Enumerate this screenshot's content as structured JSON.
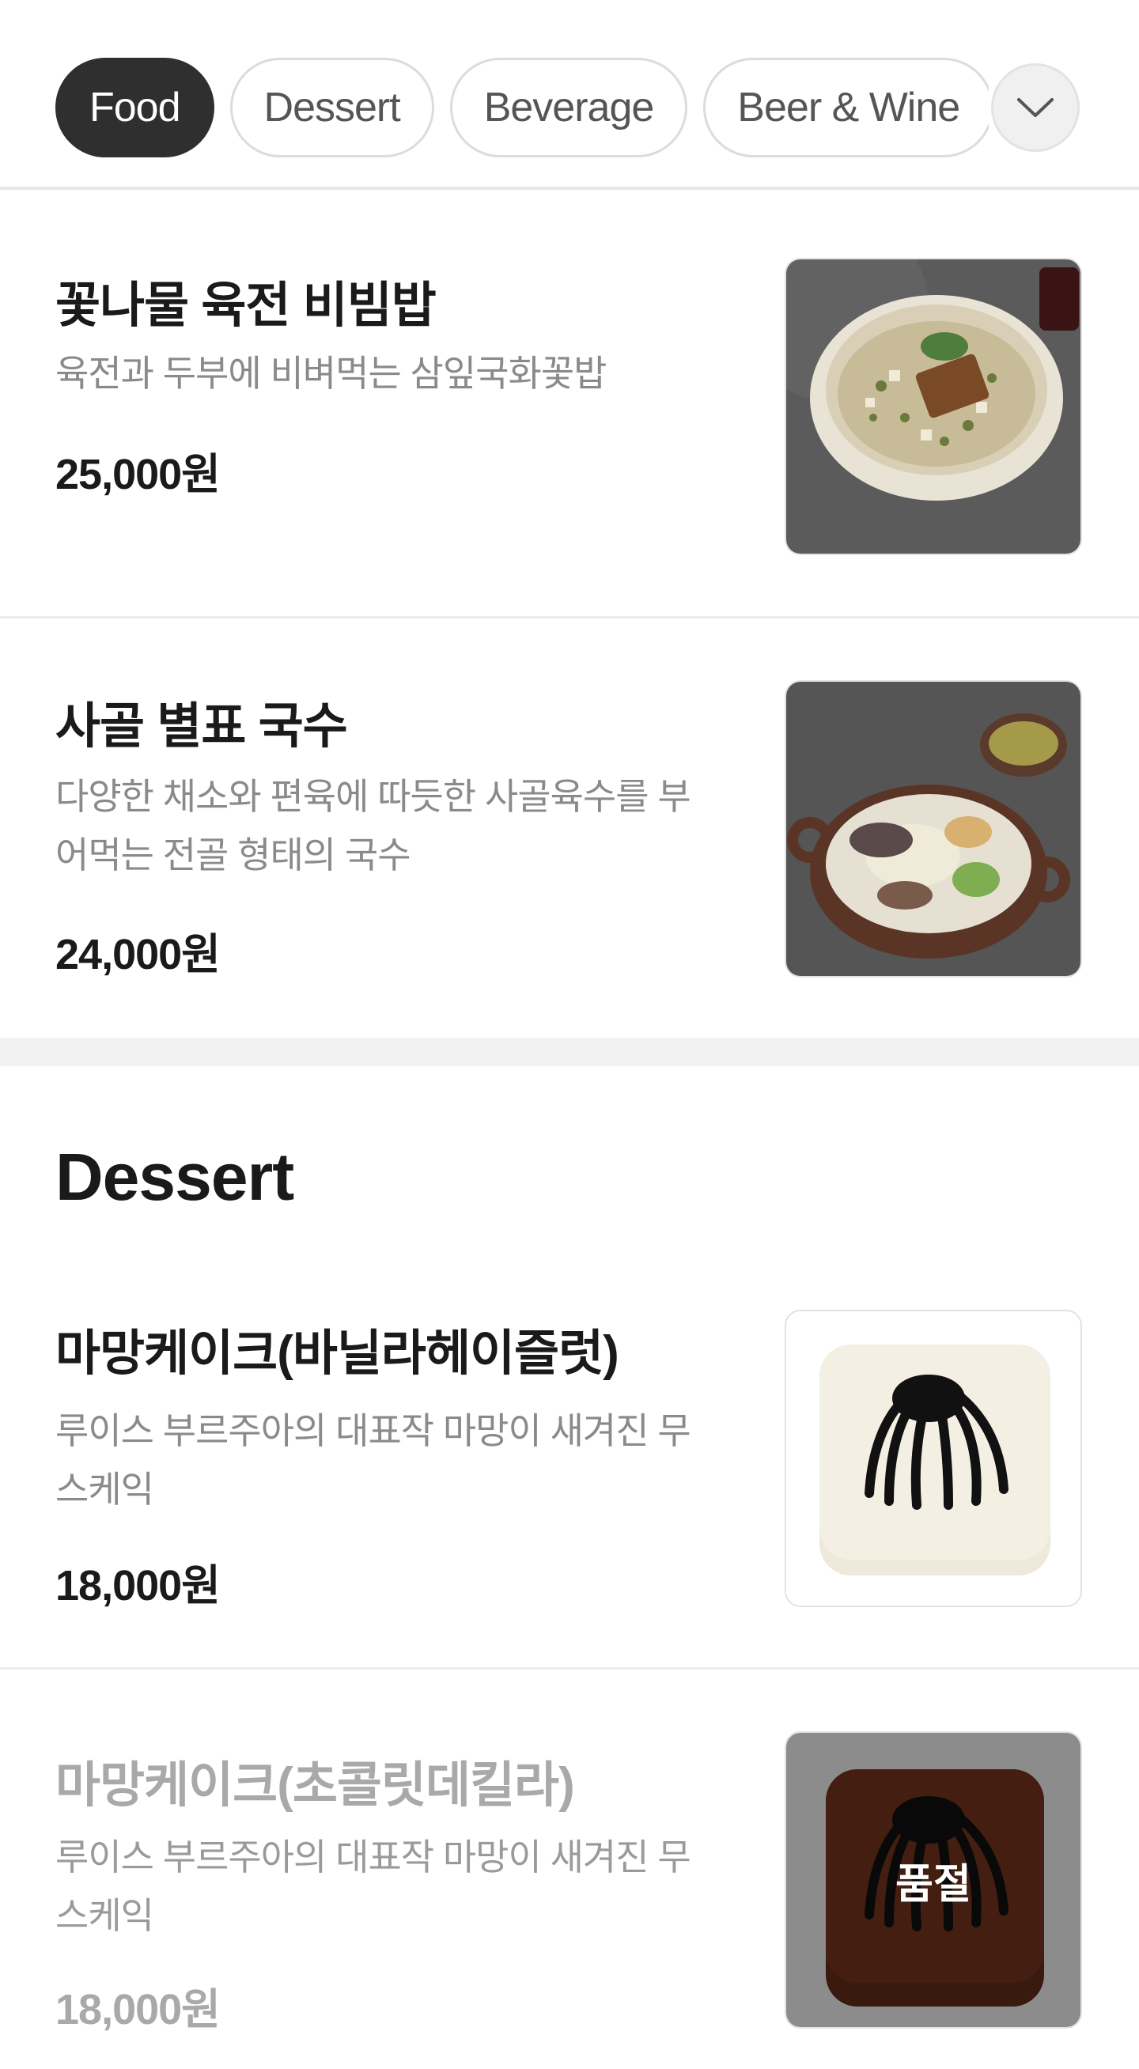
{
  "tabs": [
    {
      "label": "Food",
      "active": true
    },
    {
      "label": "Dessert",
      "active": false
    },
    {
      "label": "Beverage",
      "active": false
    },
    {
      "label": "Beer & Wine",
      "active": false
    }
  ],
  "more_icon": "chevron-down-icon",
  "items": [
    {
      "name": "꽃나물 육전 비빔밥",
      "desc": "육전과 두부에 비벼먹는 삼잎국화꽃밥",
      "price": "25,000원",
      "image": "bibimbap bowl"
    },
    {
      "name": "사골 별표 국수",
      "desc": "다양한 채소와 편육에 따듯한 사골육수를 부어먹는 전골 형태의 국수",
      "price": "24,000원",
      "image": "beef bone noodle pot"
    }
  ],
  "section": {
    "title": "Dessert"
  },
  "desserts": [
    {
      "name": "마망케이크(바닐라헤이즐럿)",
      "desc": "루이스 부르주아의 대표작 마망이 새겨진 무스케익",
      "price": "18,000원",
      "image": "vanilla mousse cake with spider"
    },
    {
      "name": "마망케이크(초콜릿데킬라)",
      "desc": "루이스 부르주아의 대표작 마망이 새겨진 무스케익",
      "price": "18,000원",
      "image": "chocolate mousse cake with spider",
      "sold_out_label": "품절"
    }
  ]
}
